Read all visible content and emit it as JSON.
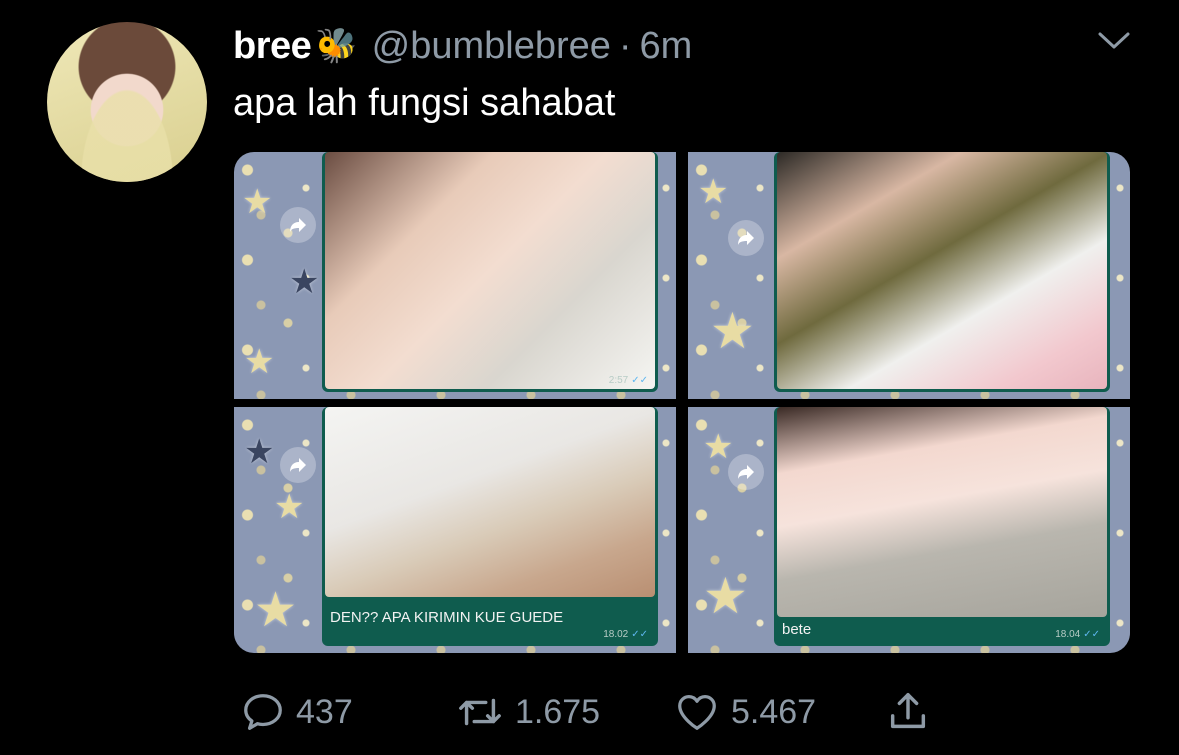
{
  "tweet": {
    "display_name": "bree",
    "emoji": "🐝",
    "handle": "@bumblebree",
    "separator": "·",
    "time": "6m",
    "text": "apa lah fungsi sahabat"
  },
  "media": {
    "tile1": {
      "stamp": "2:57"
    },
    "tile2": {
      "caption": ""
    },
    "tile3": {
      "caption": "DEN?? APA KIRIMIN KUE GUEDE",
      "stamp": "18.02"
    },
    "tile4": {
      "caption": "bete",
      "stamp": "18.04"
    }
  },
  "actions": {
    "replies": "437",
    "retweets": "1.675",
    "likes": "5.467"
  },
  "icons": [
    "chevron-down-icon",
    "forward-icon",
    "reply-icon",
    "retweet-icon",
    "like-icon",
    "share-icon",
    "double-check-icon"
  ],
  "colors": {
    "background": "#000000",
    "muted": "#8e9aa6",
    "bubble": "#0f5c4e",
    "wallpaper": "#8b98b4"
  }
}
